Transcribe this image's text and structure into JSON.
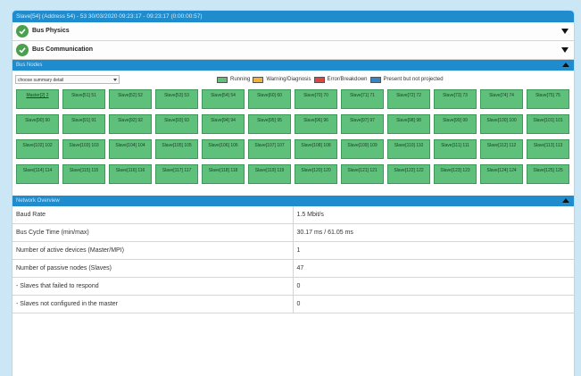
{
  "window": {
    "title": "Slave[54] (Address 54) - 53 30/03/2020 09:23:17 - 09:23:17 (0:00:00:57)"
  },
  "sections": [
    {
      "label": "Bus Physics"
    },
    {
      "label": "Bus Communication"
    }
  ],
  "bus_nodes": {
    "header": "Bus Nodes",
    "summary_select": "choose summary detail",
    "legend": [
      {
        "label": "Running",
        "color": "#5ec07a"
      },
      {
        "label": "Warning/Diagnosis",
        "color": "#f2b233"
      },
      {
        "label": "Error/Breakdown",
        "color": "#e2443f"
      },
      {
        "label": "Present but not projected",
        "color": "#2f86c9"
      }
    ],
    "nodes": [
      "Master[2] 2",
      "Slave[51] 51",
      "Slave[52] 52",
      "Slave[53] 53",
      "Slave[54] 54",
      "Slave[60] 60",
      "Slave[70] 70",
      "Slave[71] 71",
      "Slave[72] 72",
      "Slave[73] 73",
      "Slave[74] 74",
      "Slave[75] 75",
      "Slave[90] 90",
      "Slave[91] 91",
      "Slave[92] 92",
      "Slave[93] 93",
      "Slave[94] 94",
      "Slave[95] 95",
      "Slave[96] 96",
      "Slave[97] 97",
      "Slave[98] 98",
      "Slave[99] 99",
      "Slave[100] 100",
      "Slave[101] 101",
      "Slave[102] 102",
      "Slave[103] 103",
      "Slave[104] 104",
      "Slave[105] 105",
      "Slave[106] 106",
      "Slave[107] 107",
      "Slave[108] 108",
      "Slave[109] 109",
      "Slave[110] 110",
      "Slave[111] 111",
      "Slave[112] 112",
      "Slave[113] 113",
      "Slave[114] 114",
      "Slave[115] 115",
      "Slave[116] 116",
      "Slave[117] 117",
      "Slave[118] 118",
      "Slave[119] 119",
      "Slave[120] 120",
      "Slave[121] 121",
      "Slave[122] 122",
      "Slave[123] 123",
      "Slave[124] 124",
      "Slave[125] 125"
    ]
  },
  "network_overview": {
    "header": "Network Overview",
    "rows": [
      {
        "label": "Baud Rate",
        "value": "1.5 Mbit/s"
      },
      {
        "label": "Bus Cycle Time (min/max)",
        "value": "30.17 ms / 61.05 ms"
      },
      {
        "label": "Number of active devices (Master/MPI)",
        "value": "1"
      },
      {
        "label": "Number of passive nodes (Slaves)",
        "value": "47"
      },
      {
        "label": "- Slaves that failed to respond",
        "value": "0"
      },
      {
        "label": "- Slaves not configured in the master",
        "value": "0"
      }
    ]
  }
}
